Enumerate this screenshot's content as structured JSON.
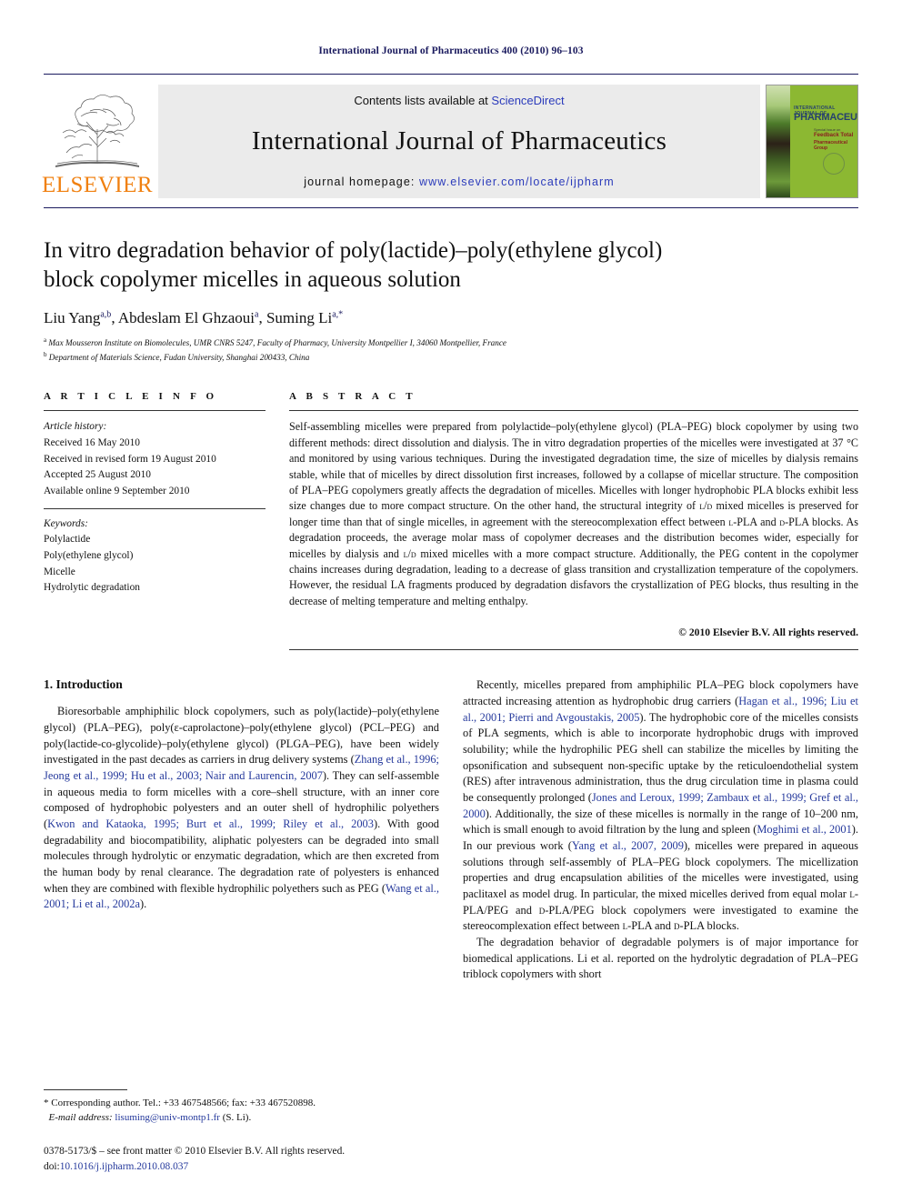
{
  "running_head": "International Journal of Pharmaceutics 400 (2010) 96–103",
  "masthead": {
    "publisher_name": "ELSEVIER",
    "contents_prefix": "Contents lists available at ",
    "sciencedirect": "ScienceDirect",
    "journal_name": "International Journal of Pharmaceutics",
    "homepage_prefix": "journal homepage: ",
    "homepage_url": "www.elsevier.com/locate/ijpharm",
    "cover": {
      "line_small": "INTERNATIONAL JOURNAL OF",
      "line_large": "PHARMACEUTICS",
      "sub1": "Special Issue on",
      "sub2": "Feedback Total",
      "sub3": "Pharmaceutical Group"
    },
    "accent_blue": "#1a1a5e",
    "link_blue": "#2b3bbb",
    "elsevier_orange": "#F08010"
  },
  "article": {
    "title": "In vitro degradation behavior of poly(lactide)–poly(ethylene glycol) block copolymer micelles in aqueous solution",
    "authors_html": "Liu Yang<sup>a,b</sup>, Abdeslam El Ghzaoui<sup>a</sup>, Suming Li<sup>a,*</sup>",
    "affiliation_a": "Max Mousseron Institute on Biomolecules, UMR CNRS 5247, Faculty of Pharmacy, University Montpellier I, 34060 Montpellier, France",
    "affiliation_b": "Department of Materials Science, Fudan University, Shanghai 200433, China"
  },
  "article_info": {
    "heading": "A R T I C L E  I N F O",
    "history_label": "Article history:",
    "history": [
      "Received 16 May 2010",
      "Received in revised form 19 August 2010",
      "Accepted 25 August 2010",
      "Available online 9 September 2010"
    ],
    "keywords_label": "Keywords:",
    "keywords": [
      "Polylactide",
      "Poly(ethylene glycol)",
      "Micelle",
      "Hydrolytic degradation"
    ]
  },
  "abstract": {
    "heading": "A B S T R A C T",
    "text": "Self-assembling micelles were prepared from polylactide–poly(ethylene glycol) (PLA–PEG) block copolymer by using two different methods: direct dissolution and dialysis. The in vitro degradation properties of the micelles were investigated at 37 °C and monitored by using various techniques. During the investigated degradation time, the size of micelles by dialysis remains stable, while that of micelles by direct dissolution first increases, followed by a collapse of micellar structure. The composition of PLA–PEG copolymers greatly affects the degradation of micelles. Micelles with longer hydrophobic PLA blocks exhibit less size changes due to more compact structure. On the other hand, the structural integrity of L/D mixed micelles is preserved for longer time than that of single micelles, in agreement with the stereocomplexation effect between L-PLA and D-PLA blocks. As degradation proceeds, the average molar mass of copolymer decreases and the distribution becomes wider, especially for micelles by dialysis and L/D mixed micelles with a more compact structure. Additionally, the PEG content in the copolymer chains increases during degradation, leading to a decrease of glass transition and crystallization temperature of the copolymers. However, the residual LA fragments produced by degradation disfavors the crystallization of PEG blocks, thus resulting in the decrease of melting temperature and melting enthalpy.",
    "copyright": "© 2010 Elsevier B.V. All rights reserved."
  },
  "sections": {
    "intro_heading": "1. Introduction",
    "left_paragraphs": [
      "Bioresorbable amphiphilic block copolymers, such as poly(lactide)–poly(ethylene glycol) (PLA–PEG), poly(ε-caprolactone)–poly(ethylene glycol) (PCL–PEG) and poly(lactide-co-glycolide)–poly(ethylene glycol) (PLGA–PEG), have been widely investigated in the past decades as carriers in drug delivery systems (Zhang et al., 1996; Jeong et al., 1999; Hu et al., 2003; Nair and Laurencin, 2007). They can self-assemble in aqueous media to form micelles with a core–shell structure, with an inner core composed of hydrophobic polyesters and an outer shell of hydrophilic polyethers (Kwon and Kataoka, 1995; Burt et al., 1999; Riley et al., 2003). With good degradability and biocompatibility, aliphatic polyesters can be degraded into small molecules through hydrolytic or enzymatic degradation, which are then excreted from the human body by renal clearance. The degradation rate of polyesters is enhanced when they are combined with flexible hydrophilic polyethers such as PEG (Wang et al., 2001; Li et al., 2002a)."
    ],
    "right_paragraphs": [
      "Recently, micelles prepared from amphiphilic PLA–PEG block copolymers have attracted increasing attention as hydrophobic drug carriers (Hagan et al., 1996; Liu et al., 2001; Pierri and Avgoustakis, 2005). The hydrophobic core of the micelles consists of PLA segments, which is able to incorporate hydrophobic drugs with improved solubility; while the hydrophilic PEG shell can stabilize the micelles by limiting the opsonification and subsequent non-specific uptake by the reticuloendothelial system (RES) after intravenous administration, thus the drug circulation time in plasma could be consequently prolonged (Jones and Leroux, 1999; Zambaux et al., 1999; Gref et al., 2000). Additionally, the size of these micelles is normally in the range of 10–200 nm, which is small enough to avoid filtration by the lung and spleen (Moghimi et al., 2001). In our previous work (Yang et al., 2007, 2009), micelles were prepared in aqueous solutions through self-assembly of PLA–PEG block copolymers. The micellization properties and drug encapsulation abilities of the micelles were investigated, using paclitaxel as model drug. In particular, the mixed micelles derived from equal molar L-PLA/PEG and D-PLA/PEG block copolymers were investigated to examine the stereocomplexation effect between L-PLA and D-PLA blocks.",
      "The degradation behavior of degradable polymers is of major importance for biomedical applications. Li et al. reported on the hydrolytic degradation of PLA–PEG triblock copolymers with short"
    ]
  },
  "footnotes": {
    "corresponding": "* Corresponding author. Tel.: +33 467548566; fax: +33 467520898.",
    "email_label": "E-mail address:",
    "email": "lisuming@univ-montp1.fr",
    "email_suffix": " (S. Li).",
    "issn_line": "0378-5173/$ – see front matter © 2010 Elsevier B.V. All rights reserved.",
    "doi_label": "doi:",
    "doi": "10.1016/j.ijpharm.2010.08.037"
  }
}
